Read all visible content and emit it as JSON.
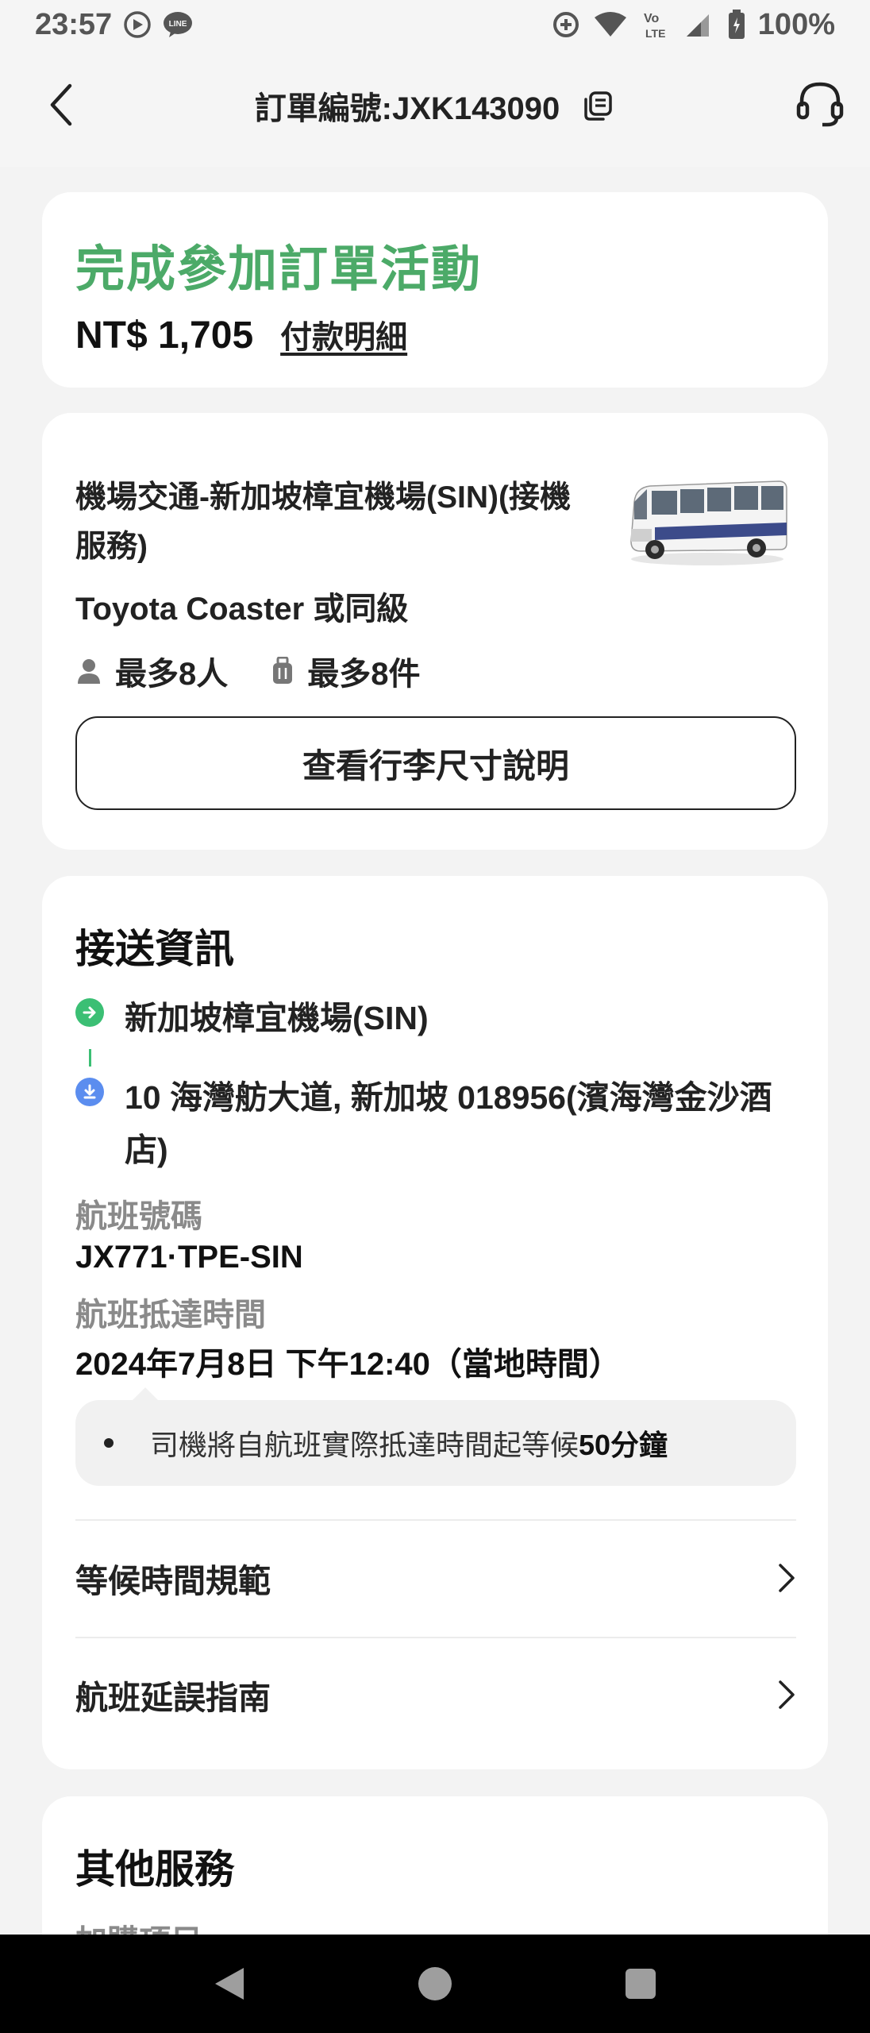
{
  "status_bar": {
    "time": "23:57",
    "battery": "100%"
  },
  "header": {
    "title": "訂單編號:JXK143090"
  },
  "order": {
    "status": "完成參加訂單活動",
    "price": "NT$ 1,705",
    "payment_link": "付款明細"
  },
  "product": {
    "title": "機場交通-新加坡樟宜機場(SIN)(接機服務)",
    "vehicle": "Toyota Coaster 或同級",
    "max_people": "最多8人",
    "max_luggage": "最多8件",
    "luggage_button": "查看行李尺寸說明"
  },
  "transfer": {
    "section_title": "接送資訊",
    "pickup": "新加坡樟宜機場(SIN)",
    "dropoff": "10 海灣舫大道, 新加坡 018956(濱海灣金沙酒店)",
    "flight_label": "航班號碼",
    "flight_value": "JX771·TPE-SIN",
    "arrival_label": "航班抵達時間",
    "arrival_value": "2024年7月8日 下午12:40（當地時間）",
    "notice_text": "司機將自航班實際抵達時間起等候",
    "notice_bold": "50分鐘",
    "waiting_policy": "等候時間規範",
    "delay_guide": "航班延誤指南"
  },
  "other": {
    "section_title": "其他服務",
    "sub_label": "加購項目"
  },
  "colors": {
    "accent_green": "#4caa68",
    "route_blue": "#5b8def",
    "background": "#f3f3f3"
  }
}
